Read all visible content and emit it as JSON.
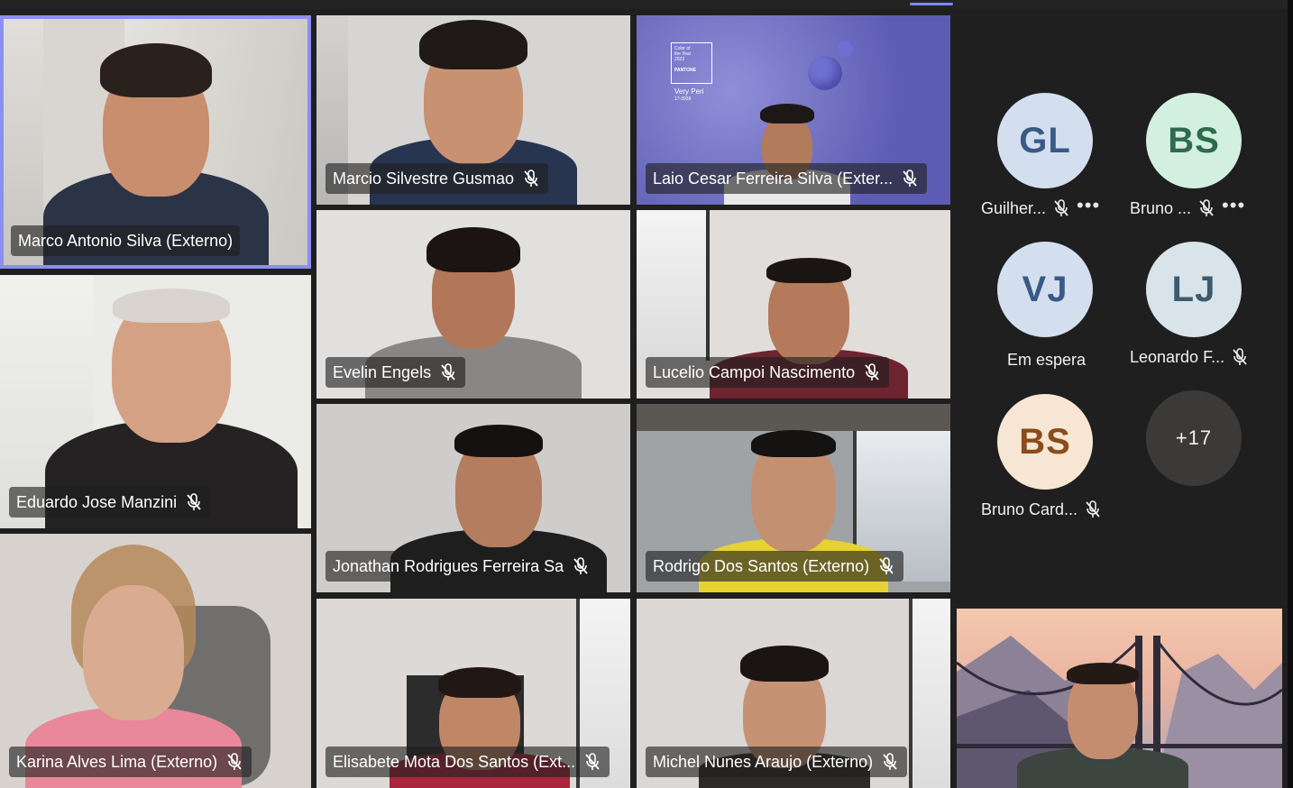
{
  "participants_video": [
    {
      "name": "Marco Antonio Silva (Externo)",
      "muted": false
    },
    {
      "name": "Marcio Silvestre Gusmao",
      "muted": true
    },
    {
      "name": "Laio Cesar Ferreira Silva (Exter...",
      "muted": true
    },
    {
      "name": "Eduardo Jose Manzini",
      "muted": true
    },
    {
      "name": "Evelin Engels",
      "muted": true
    },
    {
      "name": "Lucelio Campoi Nascimento",
      "muted": true
    },
    {
      "name": "Jonathan Rodrigues Ferreira Sa",
      "muted": true
    },
    {
      "name": "Rodrigo Dos Santos (Externo)",
      "muted": true
    },
    {
      "name": "Karina Alves Lima (Externo)",
      "muted": true
    },
    {
      "name": "Elisabete Mota Dos Santos (Ext...",
      "muted": true
    },
    {
      "name": "Michel Nunes Araujo (Externo)",
      "muted": true
    }
  ],
  "pantone_card": {
    "line1": "Color of",
    "line2": "the Year",
    "line3": "2022",
    "brand": "PANTONE",
    "color_name": "Very Peri",
    "code": "17-3938"
  },
  "participants_avatar": [
    {
      "initials": "GL",
      "label": "Guilher...",
      "bg": "#d3dfee",
      "fg": "#3a5a86"
    },
    {
      "initials": "BS",
      "label": "Bruno ...",
      "bg": "#d3efdf",
      "fg": "#2e6b4d"
    },
    {
      "initials": "VJ",
      "label": "Em espera",
      "bg": "#d3dfee",
      "fg": "#3a5a86"
    },
    {
      "initials": "LJ",
      "label": "Leonardo F...",
      "bg": "#d8e3ea",
      "fg": "#3e5a6e"
    },
    {
      "initials": "BS",
      "label": "Bruno Card...",
      "bg": "#f8e6d4",
      "fg": "#8a4c1c"
    }
  ],
  "overflow_count": "+17",
  "colors": {
    "accent": "#7f85f5",
    "background": "#1f1f1f"
  }
}
